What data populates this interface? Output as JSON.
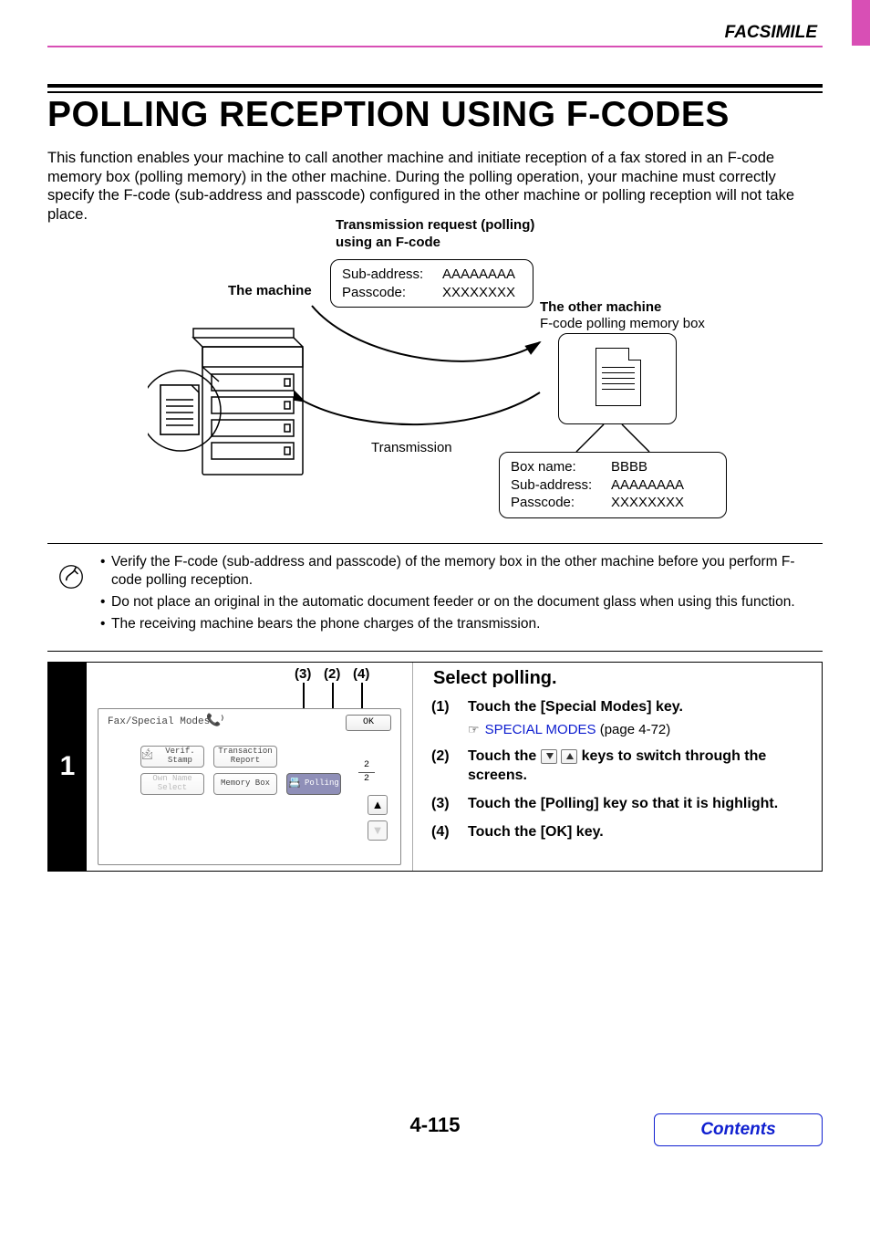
{
  "header": {
    "section": "FACSIMILE"
  },
  "title": "POLLING RECEPTION USING F-CODES",
  "intro": "This function enables your machine to call another machine and initiate reception of a fax stored in an F-code memory box (polling memory) in the other machine. During the polling operation, your machine must correctly specify the F-code (sub-address and passcode) configured in the other machine or polling reception will not take place.",
  "diagram": {
    "request_title": "Transmission request (polling) using an F-code",
    "machine_label": "The machine",
    "other_label": "The other machine",
    "other_sub": "F-code polling memory box",
    "transmission": "Transmission",
    "fcode_box": {
      "sub_label": "Sub-address:",
      "sub_value": "AAAAAAAA",
      "pass_label": "Passcode:",
      "pass_value": "XXXXXXXX"
    },
    "memory_box": {
      "name_label": "Box name:",
      "name_value": "BBBB",
      "sub_label": "Sub-address:",
      "sub_value": "AAAAAAAA",
      "pass_label": "Passcode:",
      "pass_value": "XXXXXXXX"
    }
  },
  "notes": [
    "Verify the F-code (sub-address and passcode) of the memory box in the other machine before you perform F-code polling reception.",
    "Do not place an original in the automatic document feeder or on the document glass when using this function.",
    "The receiving machine bears the phone charges of the transmission."
  ],
  "step": {
    "number": "1",
    "markers": {
      "a": "(3)",
      "b": "(2)",
      "c": "(4)"
    },
    "panel": {
      "title": "Fax/Special Modes",
      "ok": "OK",
      "buttons": {
        "verif": "Verif. Stamp",
        "trans": "Transaction Report",
        "own": "Own Name Select",
        "memory": "Memory Box",
        "polling": "Polling"
      },
      "page_cur": "2",
      "page_tot": "2"
    },
    "heading": "Select polling.",
    "items": [
      {
        "n": "(1)",
        "bold": "Touch the [Special Modes] key.",
        "link_text": "SPECIAL MODES",
        "link_after": " (page 4-72)"
      },
      {
        "n": "(2)",
        "bold_before": "Touch the ",
        "bold_after": " keys to switch through the screens."
      },
      {
        "n": "(3)",
        "bold": "Touch the [Polling] key so that it is highlight."
      },
      {
        "n": "(4)",
        "bold": "Touch the [OK] key."
      }
    ]
  },
  "footer": {
    "page": "4-115",
    "contents": "Contents"
  }
}
